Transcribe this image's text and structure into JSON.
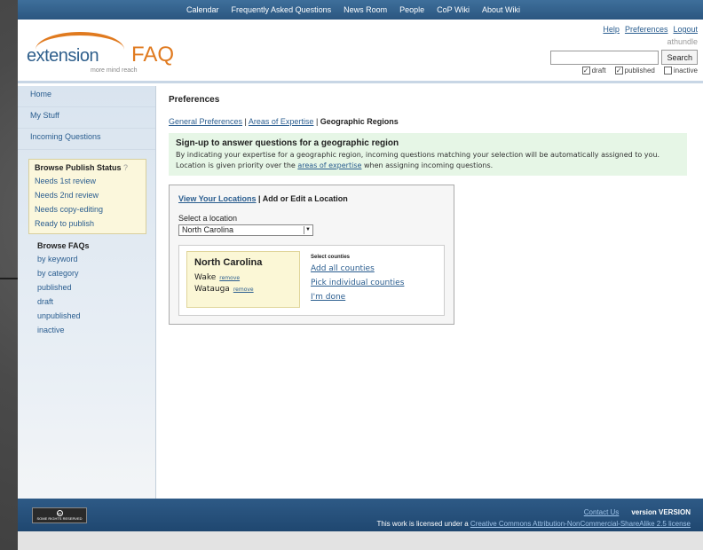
{
  "topnav": [
    "Calendar",
    "Frequently Asked Questions",
    "News Room",
    "People",
    "CoP Wiki",
    "About Wiki"
  ],
  "header": {
    "logo_text": "extension",
    "logo_faq": "FAQ",
    "logo_tagline": "more mind reach",
    "links": [
      "Help",
      "Preferences",
      "Logout"
    ],
    "username": "athundle",
    "search_button": "Search",
    "filters": [
      {
        "label": "draft",
        "checked": true
      },
      {
        "label": "published",
        "checked": true
      },
      {
        "label": "inactive",
        "checked": false
      }
    ]
  },
  "sidebar": {
    "nav": [
      "Home",
      "My Stuff",
      "Incoming Questions"
    ],
    "publish_box": {
      "title": "Browse Publish Status",
      "help": "?",
      "items": [
        "Needs 1st review",
        "Needs 2nd review",
        "Needs copy-editing",
        "Ready to publish"
      ]
    },
    "browse": {
      "title": "Browse FAQs",
      "items": [
        "by keyword",
        "by category",
        "published",
        "draft",
        "unpublished",
        "inactive"
      ]
    }
  },
  "main": {
    "title": "Preferences",
    "crumbs": {
      "general": "General Preferences",
      "sep1": " | ",
      "areas": "Areas of Expertise",
      "sep2": " | ",
      "current": "Geographic Regions"
    },
    "info": {
      "title": "Sign-up to answer questions for a geographic region",
      "line1": "By indicating your expertise for a geographic region, incoming questions matching your selection will be automatically assigned to you.",
      "line2_pre": "Location is given priority over the ",
      "line2_link": "areas of expertise",
      "line2_post": " when assigning incoming questions."
    },
    "locbox": {
      "view_link": "View Your Locations",
      "sep": " | ",
      "add_edit": "Add or Edit a Location",
      "select_label": "Select a location",
      "selected": "North Carolina",
      "state": "North Carolina",
      "counties": [
        {
          "name": "Wake",
          "action": "remove"
        },
        {
          "name": "Watauga",
          "action": "remove"
        }
      ],
      "select_counties_label": "Select counties",
      "actions": [
        "Add all counties",
        "Pick individual counties",
        "I'm done"
      ]
    }
  },
  "footer": {
    "cc_badge": "SOME RIGHTS RESERVED",
    "contact": "Contact Us",
    "version": "version VERSION",
    "license_pre": "This work is licensed under a ",
    "license_link": "Creative Commons Attribution-NonCommercial-ShareAlike 2.5 license"
  }
}
